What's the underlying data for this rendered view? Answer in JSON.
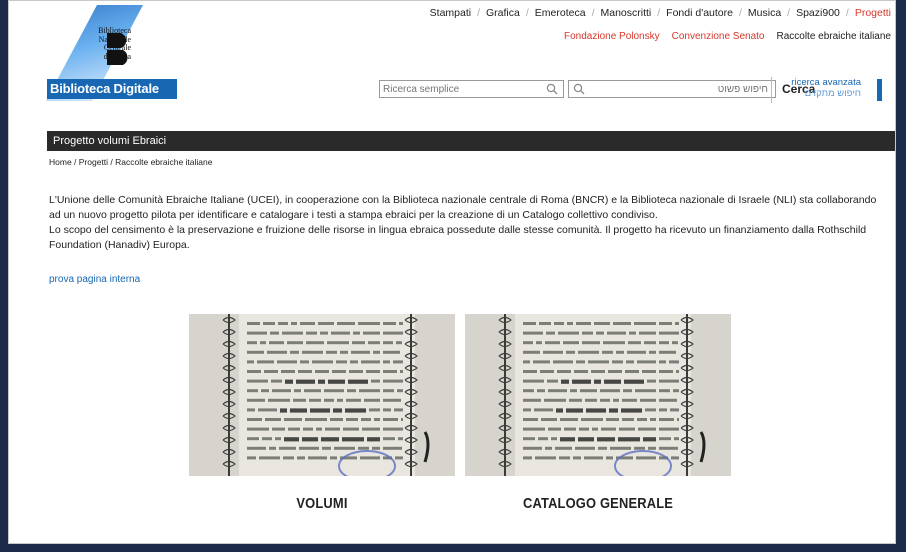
{
  "logo": {
    "lines": [
      "Biblioteca",
      "Nazionale",
      "Centrale",
      "di Roma"
    ],
    "digitale": "Biblioteca Digitale"
  },
  "topnav": [
    "Stampati",
    "Grafica",
    "Emeroteca",
    "Manoscritti",
    "Fondi d'autore",
    "Musica",
    "Spazi900",
    "Progetti"
  ],
  "subnav": {
    "links": [
      "Fondazione Polonsky",
      "Convenzione Senato"
    ],
    "current": "Raccolte ebraiche italiane"
  },
  "search": {
    "simple_placeholder": "Ricerca semplice",
    "hebrew_placeholder": "חיפוש פשוט",
    "button": "Cerca",
    "advanced": "ricerca avanzata",
    "advanced_he": "חיפוש מתקדם"
  },
  "page": {
    "title": "Progetto volumi Ebraici",
    "breadcrumb": "Home / Progetti / Raccolte ebraiche italiane",
    "para1": "L'Unione delle Comunità Ebraiche Italiane (UCEI), in cooperazione con la Biblioteca nazionale centrale di Roma (BNCR) e la Biblioteca nazionale di Israele (NLI) sta collaborando ad un nuovo progetto pilota per identificare e catalogare i testi a stampa ebraici per la creazione di un Catalogo collettivo condiviso.",
    "para2": "Lo scopo del censimento è la preservazione e fruizione delle risorse in lingua ebraica possedute dalle stesse comunità. Il progetto ha ricevuto un finanziamento dalla Rothschild Foundation (Hanadiv) Europa.",
    "link": "prova pagina interna"
  },
  "cards": [
    {
      "label": "VOLUMI"
    },
    {
      "label": "CATALOGO GENERALE"
    }
  ],
  "colors": {
    "accent": "#1767b3",
    "active": "#d7372a",
    "titlebar": "#2a2a2a"
  }
}
